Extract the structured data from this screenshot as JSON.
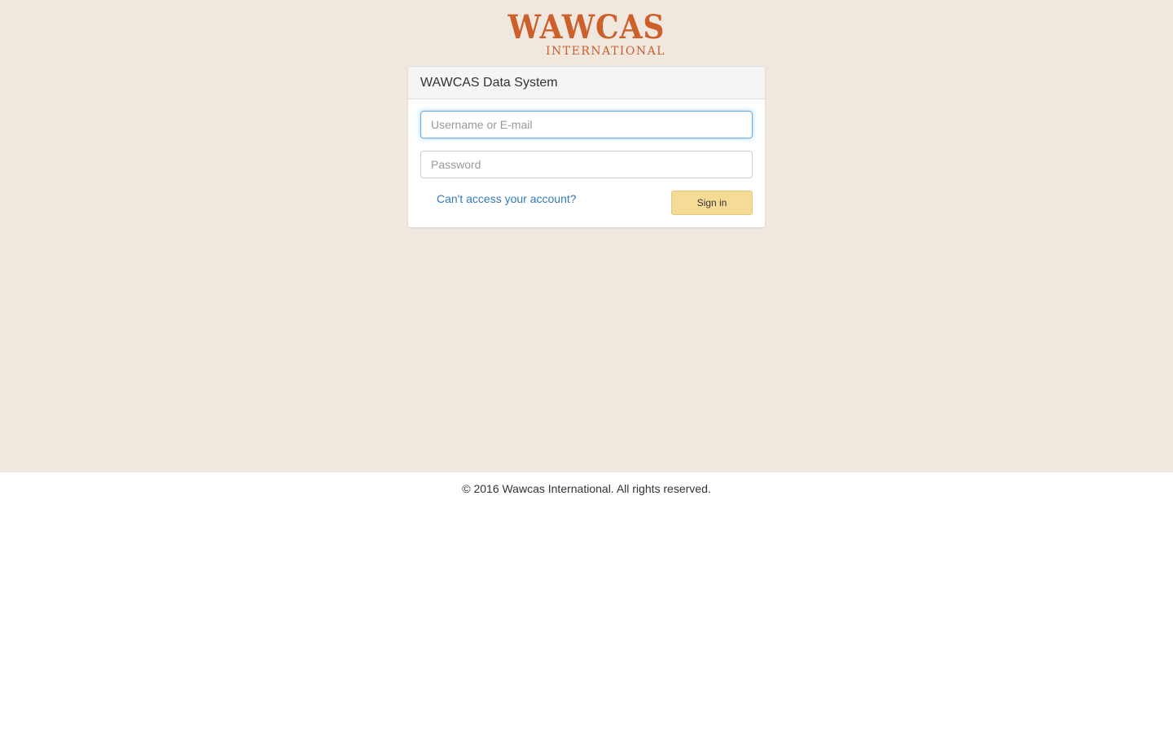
{
  "logo": {
    "main": "WAWCAS",
    "sub": "INTERNATIONAL"
  },
  "panel": {
    "title": "WAWCAS Data System"
  },
  "form": {
    "username_placeholder": "Username or E-mail",
    "username_value": "",
    "password_placeholder": "Password",
    "password_value": "",
    "forgot_link": "Can't access your account?",
    "signin_label": "Sign in"
  },
  "footer": {
    "text": "© 2016 Wawcas International. All rights reserved."
  },
  "colors": {
    "background": "#f0e7df",
    "brand": "#cc5f2a",
    "link": "#337ab7",
    "signin_button": "#f5dc96"
  }
}
